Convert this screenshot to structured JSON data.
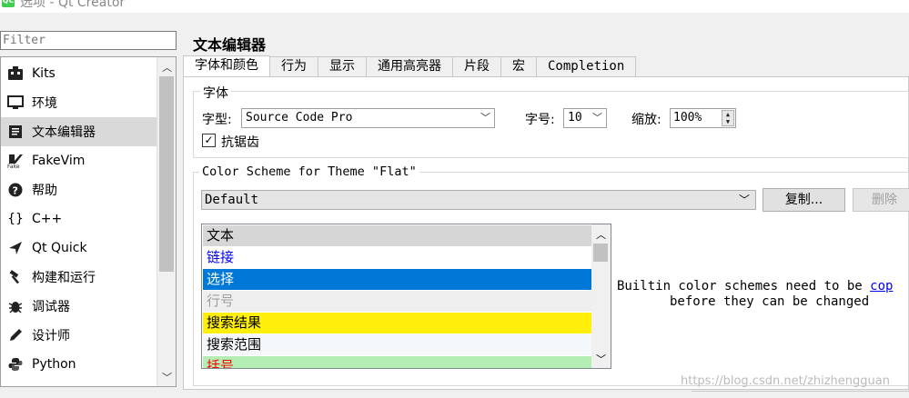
{
  "window": {
    "title": "选项 - Qt Creator"
  },
  "filter": {
    "placeholder": "Filter"
  },
  "nav": {
    "items": [
      {
        "label": "Kits",
        "icon": "kits-icon"
      },
      {
        "label": "环境",
        "icon": "monitor-icon"
      },
      {
        "label": "文本编辑器",
        "icon": "text-editor-icon"
      },
      {
        "label": "FakeVim",
        "icon": "fakevim-icon"
      },
      {
        "label": "帮助",
        "icon": "help-icon"
      },
      {
        "label": "C++",
        "icon": "braces-icon"
      },
      {
        "label": "Qt Quick",
        "icon": "qtquick-icon"
      },
      {
        "label": "构建和运行",
        "icon": "hammer-icon"
      },
      {
        "label": "调试器",
        "icon": "bug-icon"
      },
      {
        "label": "设计师",
        "icon": "pen-icon"
      },
      {
        "label": "Python",
        "icon": "python-icon"
      }
    ]
  },
  "main": {
    "title": "文本编辑器",
    "tabs": [
      {
        "label": "字体和颜色"
      },
      {
        "label": "行为"
      },
      {
        "label": "显示"
      },
      {
        "label": "通用高亮器"
      },
      {
        "label": "片段"
      },
      {
        "label": "宏"
      },
      {
        "label": "Completion"
      }
    ],
    "font_group": {
      "title": "字体",
      "family_label": "字型:",
      "family_value": "Source Code Pro",
      "size_label": "字号:",
      "size_value": "10",
      "zoom_label": "缩放:",
      "zoom_value": "100%",
      "antialias_label": "抗锯齿",
      "antialias_checked": true
    },
    "scheme_group": {
      "title": "Color Scheme for Theme \"Flat\"",
      "scheme_value": "Default",
      "copy_button": "复制...",
      "delete_button": "删除"
    },
    "categories": [
      {
        "label": "文本",
        "bg": "#d6d6d6",
        "fg": "#000000"
      },
      {
        "label": "链接",
        "bg": "#ffffff",
        "fg": "#0000ff"
      },
      {
        "label": "选择",
        "bg": "#0078d7",
        "fg": "#ffffff"
      },
      {
        "label": "行号",
        "bg": "#efefef",
        "fg": "#9f9f9f"
      },
      {
        "label": "搜索结果",
        "bg": "#ffef0b",
        "fg": "#000000"
      },
      {
        "label": "搜索范围",
        "bg": "#f5f8fb",
        "fg": "#000000"
      },
      {
        "label": "括号",
        "bg": "#b4eeb4",
        "fg": "#ff0000"
      }
    ],
    "info": {
      "line1_prefix": "Builtin color schemes need to be ",
      "line1_link": "cop",
      "line2": "before they can be changed"
    }
  },
  "watermark": "https://blog.csdn.net/zhizhengguan"
}
